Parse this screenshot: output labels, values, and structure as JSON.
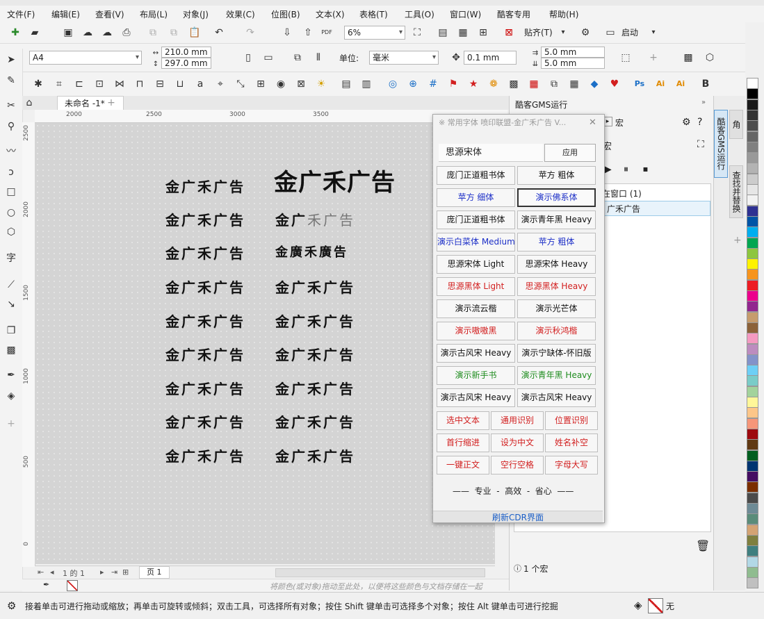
{
  "menu": [
    "文件(F)",
    "编辑(E)",
    "查看(V)",
    "布局(L)",
    "对象(J)",
    "效果(C)",
    "位图(B)",
    "文本(X)",
    "表格(T)",
    "工具(O)",
    "窗口(W)",
    "酷客专用",
    "帮助(H)"
  ],
  "toolbar": {
    "zoom_value": "6%",
    "paste_label": "贴齐(T)",
    "launch_label": "启动"
  },
  "propbar": {
    "paper": "A4",
    "width": "210.0 mm",
    "height": "297.0 mm",
    "unit_label": "单位:",
    "unit": "毫米",
    "nudge": "0.1 mm",
    "dup_x": "5.0 mm",
    "dup_y": "5.0 mm"
  },
  "doc": {
    "tab_title": "未命名 -1*",
    "page_label": "页 1",
    "page_counter": "1 的 1"
  },
  "ruler_h": [
    "2000",
    "2500",
    "3000",
    "3500"
  ],
  "ruler_v": [
    "2500",
    "2000",
    "1500",
    "1000",
    "500",
    "0"
  ],
  "canvas": {
    "left_samples": [
      "金广禾广告",
      "金广禾广告",
      "金广禾广告",
      "金广禾广告",
      "金广禾广告",
      "金广禾广告",
      "金广禾广告",
      "金广禾广告",
      "金广禾广告"
    ],
    "right_title": "金广禾广告",
    "right_samples": [
      {
        "lead": "金广",
        "tail": "禾广告"
      },
      {
        "lead": "金廣禾廣告",
        "tail": ""
      },
      {
        "lead": "金广禾广告",
        "tail": ""
      },
      {
        "lead": "金广禾广告",
        "tail": ""
      },
      {
        "lead": "金广禾广告",
        "tail": ""
      },
      {
        "lead": "金广禾广告",
        "tail": ""
      },
      {
        "lead": "金广禾广告",
        "tail": ""
      },
      {
        "lead": "金广禾广告",
        "tail": ""
      }
    ]
  },
  "dialog": {
    "title": "※ 常用字体 喷印联盟-金广禾广告 V...",
    "font_input": "思源宋体",
    "apply_label": "应用",
    "font_buttons": [
      {
        "label": "庞门正道粗书体",
        "color": "black"
      },
      {
        "label": "苹方 粗体",
        "color": "black"
      },
      {
        "label": "苹方 细体",
        "color": "blue"
      },
      {
        "label": "演示佛系体",
        "color": "blue",
        "selected": true
      },
      {
        "label": "庞门正道粗书体",
        "color": "black"
      },
      {
        "label": "演示青年黑 Heavy",
        "color": "black"
      },
      {
        "label": "演示白菜体 Medium",
        "color": "blue"
      },
      {
        "label": "苹方 粗体",
        "color": "blue"
      },
      {
        "label": "思源宋体 Light",
        "color": "black"
      },
      {
        "label": "思源宋体 Heavy",
        "color": "black"
      },
      {
        "label": "思源黑体 Light",
        "color": "red"
      },
      {
        "label": "思源黑体 Heavy",
        "color": "red"
      },
      {
        "label": "演示流云楷",
        "color": "black"
      },
      {
        "label": "演示光芒体",
        "color": "black"
      },
      {
        "label": "演示嗷嗷黑",
        "color": "red"
      },
      {
        "label": "演示秋鸿楷",
        "color": "red"
      },
      {
        "label": "演示古风宋 Heavy",
        "color": "black"
      },
      {
        "label": "演示宁缺体-怀旧版",
        "color": "black"
      },
      {
        "label": "演示新手书",
        "color": "green"
      },
      {
        "label": "演示青年黑 Heavy",
        "color": "green"
      },
      {
        "label": "演示古风宋 Heavy",
        "color": "black"
      },
      {
        "label": "演示古风宋 Heavy",
        "color": "black"
      }
    ],
    "tool_buttons": [
      "选中文本",
      "通用识别",
      "位置识别",
      "首行缩进",
      "设为中文",
      "姓名补空",
      "一键正文",
      "空行空格",
      "字母大写"
    ],
    "slogan": "——  专业  -  高效  -  省心  ——",
    "refresh_label": "刷新CDR界面"
  },
  "docker": {
    "header": "酷客GMS运行",
    "tab_macro": "宏",
    "section": "宏",
    "tree_parent": "在窗口 (1)",
    "tree_child": "广禾广告",
    "footer": "1 个宏",
    "vtabs": [
      "酷客GMS运行",
      "查找并替换",
      "角"
    ]
  },
  "hint": "将颜色(或对象)拖动至此处，以便将这些颜色与文档存储在一起",
  "status": {
    "text": "接着单击可进行拖动或缩放；再单击可旋转或倾斜；双击工具，可选择所有对象；按住 Shift 键单击可选择多个对象；按住 Alt 键单击可进行挖掘",
    "fill": "无"
  },
  "palette": [
    "#ffffff",
    "#000000",
    "#1a1a1a",
    "#333333",
    "#4d4d4d",
    "#666666",
    "#808080",
    "#999999",
    "#b3b3b3",
    "#cccccc",
    "#e6e6e6",
    "#f2f2f2",
    "#2e3192",
    "#0054a6",
    "#00aeef",
    "#00a651",
    "#8dc63f",
    "#fff200",
    "#f7941d",
    "#ed1c24",
    "#ec008c",
    "#92278f",
    "#c69c6d",
    "#8c6239",
    "#f49ac1",
    "#bd8cbf",
    "#8393ca",
    "#6dcff6",
    "#7accc8",
    "#a3d39c",
    "#fff799",
    "#fdc689",
    "#f69679",
    "#9e0b0f",
    "#603913",
    "#005e20",
    "#003471",
    "#440e62",
    "#7b2e00",
    "#4b4b4b",
    "#6e8b96",
    "#5a8c7a",
    "#d4a373",
    "#7f7f3f",
    "#3f7f7f",
    "#b2d8e6",
    "#8fbc8f",
    "#c0c0c0"
  ]
}
